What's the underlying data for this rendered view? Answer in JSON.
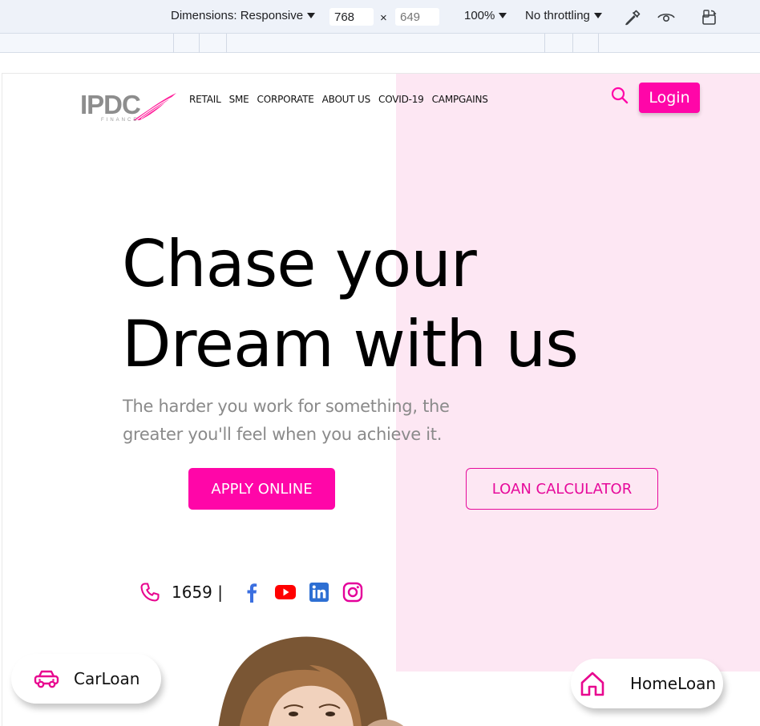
{
  "devtools": {
    "dimensions_label": "Dimensions: Responsive",
    "width_value": "768",
    "times": "×",
    "height_placeholder": "649",
    "zoom": "100%",
    "throttling": "No throttling"
  },
  "site": {
    "logo": {
      "text": "IPDC",
      "sub": "FINANCE"
    },
    "nav": [
      "RETAIL",
      "SME",
      "CORPORATE",
      "ABOUT US",
      "COVID-19",
      "CAMPGAINS"
    ],
    "login_label": "Login",
    "hero": {
      "title_line1": "Chase your",
      "title_line2": "Dream with us",
      "subtitle": "The harder you work for something, the greater you'll feel when you achieve it."
    },
    "apply_label": "APPLY ONLINE",
    "calculator_label": "LOAN CALCULATOR",
    "hotline": "1659 |",
    "social": [
      "facebook-icon",
      "youtube-icon",
      "linkedin-icon",
      "instagram-icon"
    ],
    "carloan_label": "CarLoan",
    "homeloan_label": "HomeLoan"
  },
  "colors": {
    "brand_pink": "#ff06a8",
    "panel_pink": "#fde7f3",
    "facebook": "#3b6fe0",
    "youtube": "#ff0000",
    "linkedin": "#2d6fd3",
    "instagram": "#e4009a"
  }
}
